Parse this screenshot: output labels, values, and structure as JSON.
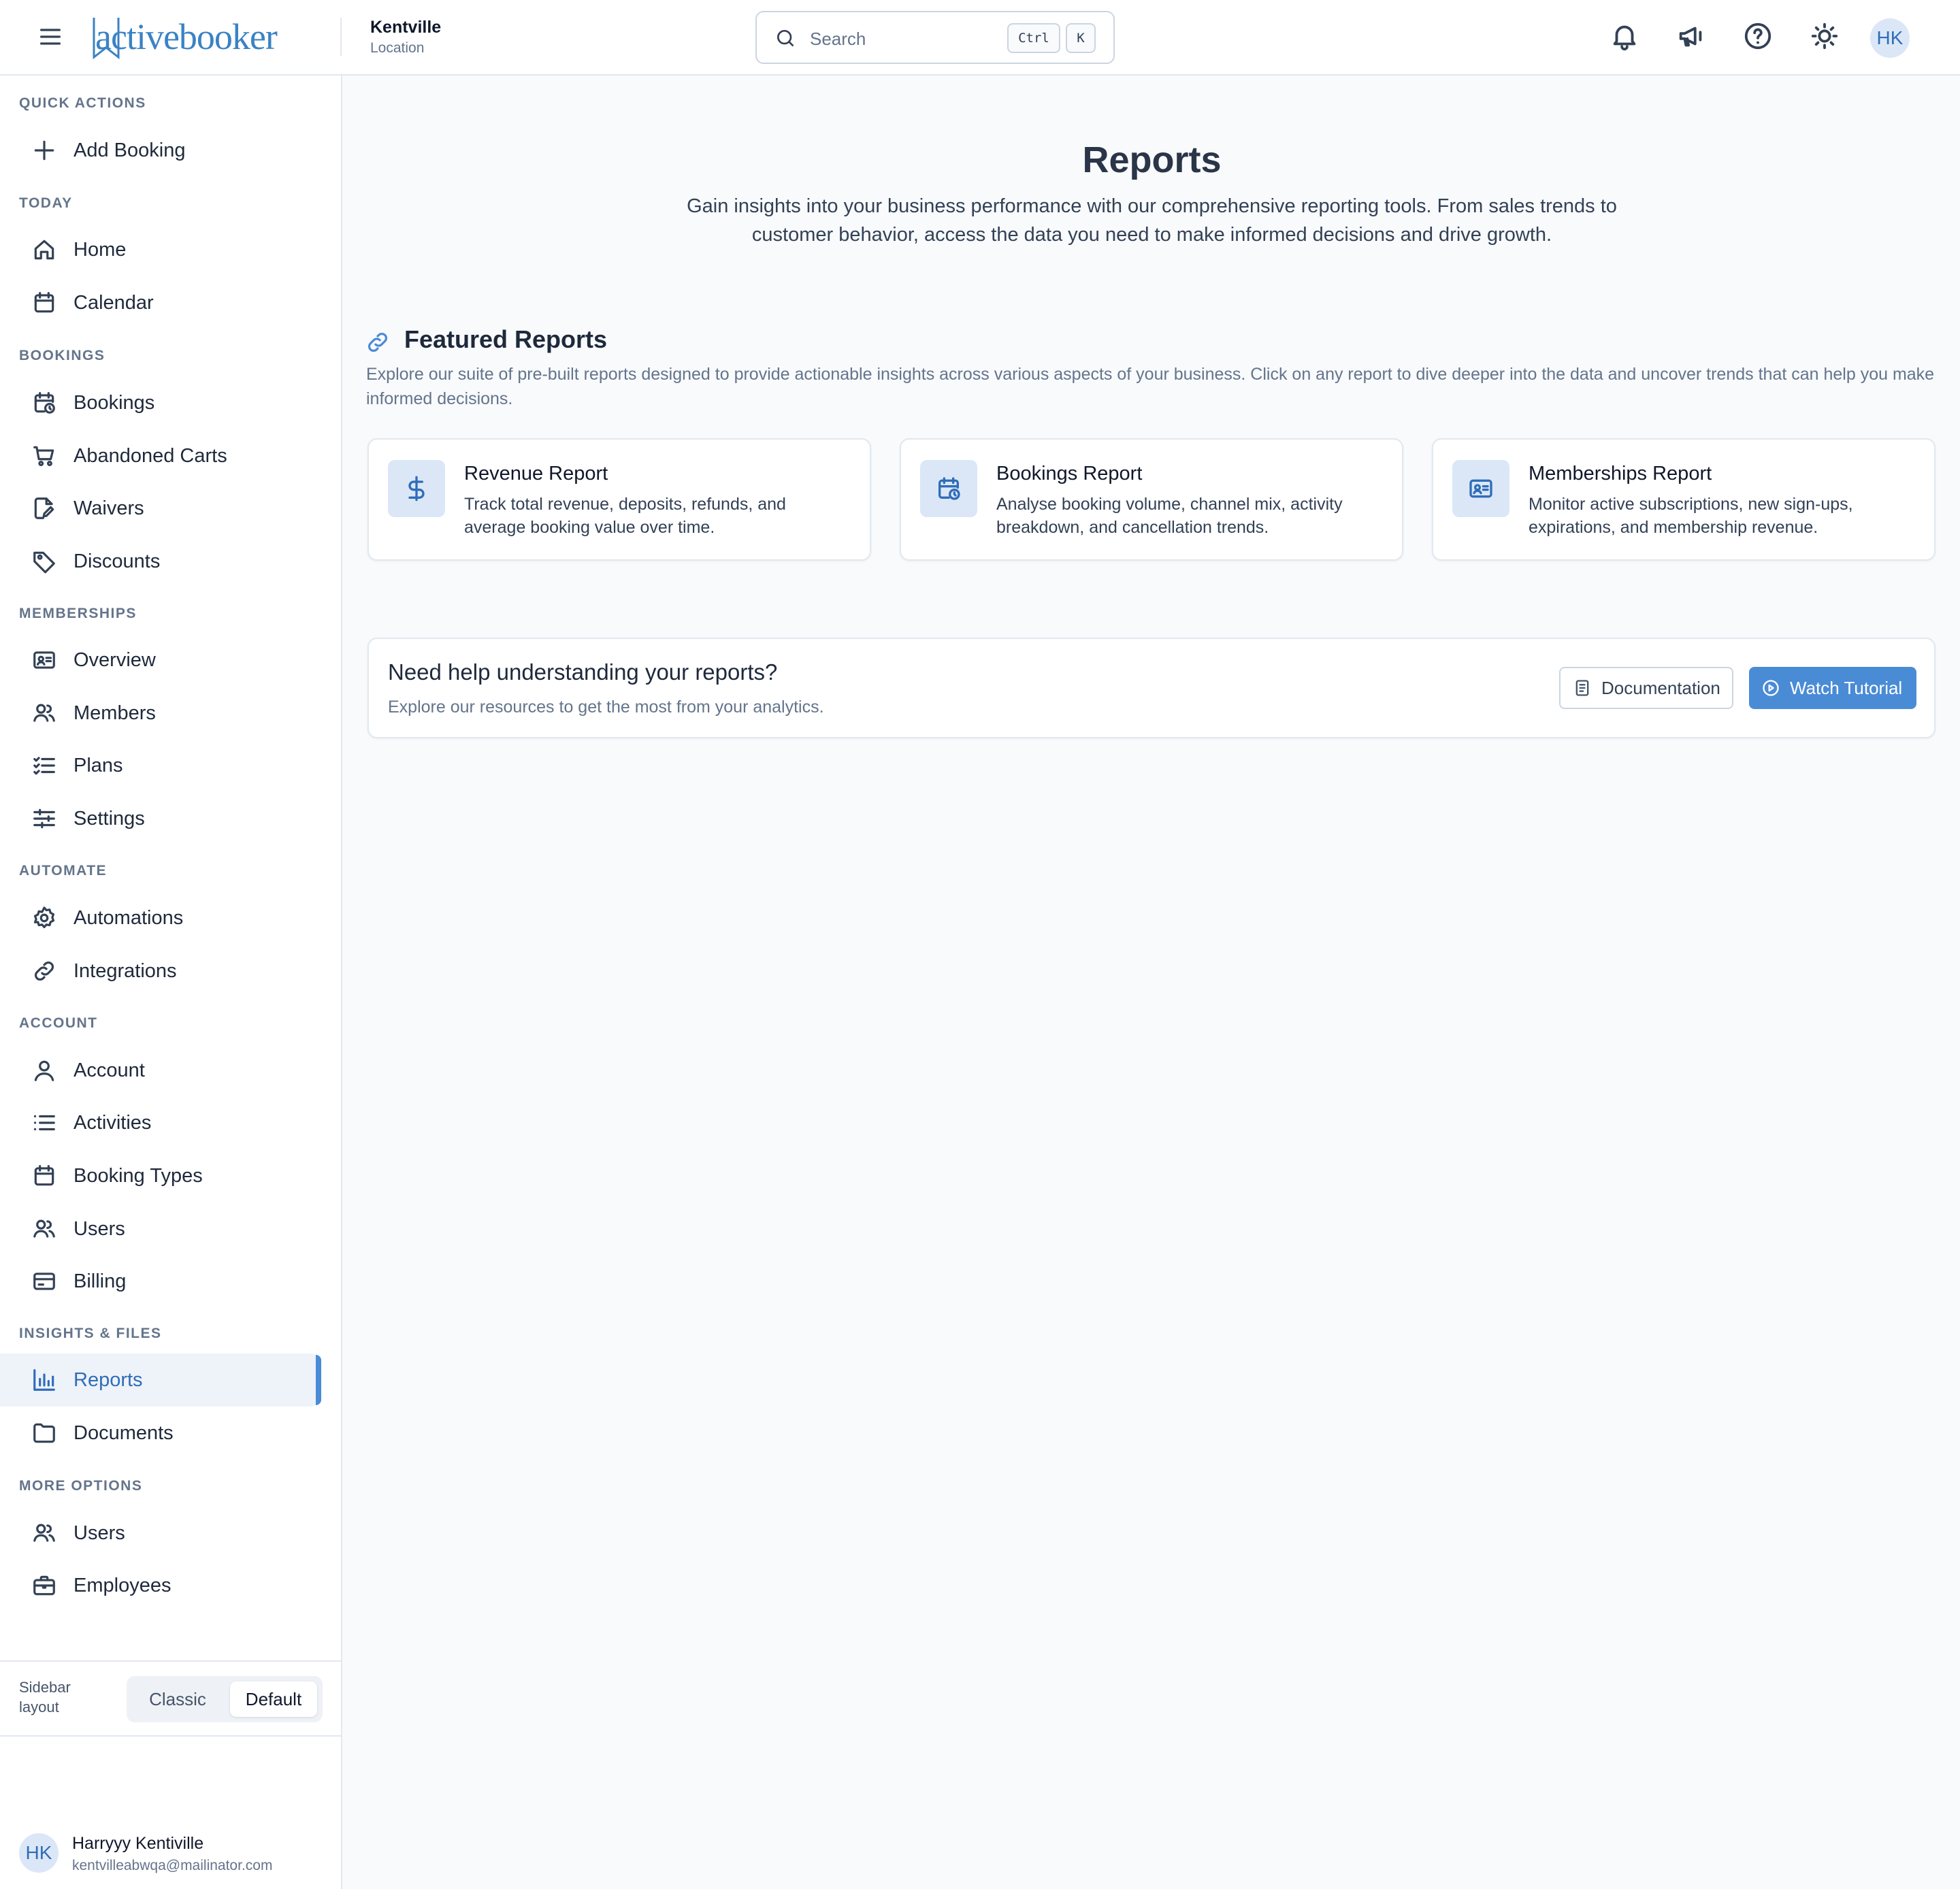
{
  "header": {
    "logo_text": "activebooker",
    "location_name": "Kentville",
    "location_label": "Location",
    "search_placeholder": "Search",
    "shortcut_ctrl": "Ctrl",
    "shortcut_key": "K",
    "avatar_initials": "HK"
  },
  "sidebar": {
    "sections": {
      "quick_actions": "QUICK ACTIONS",
      "today": "TODAY",
      "bookings": "BOOKINGS",
      "memberships": "MEMBERSHIPS",
      "automate": "AUTOMATE",
      "account": "ACCOUNT",
      "insights": "INSIGHTS & FILES",
      "more": "MORE OPTIONS"
    },
    "items": {
      "add_booking": "Add Booking",
      "home": "Home",
      "calendar": "Calendar",
      "bookings": "Bookings",
      "abandoned_carts": "Abandoned Carts",
      "waivers": "Waivers",
      "discounts": "Discounts",
      "overview": "Overview",
      "members": "Members",
      "plans": "Plans",
      "settings": "Settings",
      "automations": "Automations",
      "integrations": "Integrations",
      "account": "Account",
      "activities": "Activities",
      "booking_types": "Booking Types",
      "users": "Users",
      "billing": "Billing",
      "reports": "Reports",
      "documents": "Documents",
      "more_users": "Users",
      "employees": "Employees"
    },
    "active_item": "Reports",
    "layout_label": "Sidebar layout",
    "layout_options": [
      "Classic",
      "Default"
    ],
    "layout_selected": "Default",
    "user": {
      "initials": "HK",
      "name": "Harryyy Kentiville",
      "email": "kentvilleabwqa@mailinator.com"
    }
  },
  "main": {
    "title": "Reports",
    "subtitle": "Gain insights into your business performance with our comprehensive reporting tools. From sales trends to customer behavior, access the data you need to make informed decisions and drive growth.",
    "featured": {
      "title": "Featured Reports",
      "description": "Explore our suite of pre-built reports designed to provide actionable insights across various aspects of your business. Click on any report to dive deeper into the data and uncover trends that can help you make informed decisions.",
      "cards": [
        {
          "title": "Revenue Report",
          "description": "Track total revenue, deposits, refunds, and average booking value over time.",
          "icon": "dollar-icon"
        },
        {
          "title": "Bookings Report",
          "description": "Analyse booking volume, channel mix, activity breakdown, and cancellation trends.",
          "icon": "calendar-clock-icon"
        },
        {
          "title": "Memberships Report",
          "description": "Monitor active subscriptions, new sign-ups, expirations, and membership revenue.",
          "icon": "id-card-icon"
        }
      ]
    },
    "help": {
      "title": "Need help understanding your reports?",
      "subtitle": "Explore our resources to get the most from your analytics.",
      "documentation_label": "Documentation",
      "tutorial_label": "Watch Tutorial"
    }
  },
  "colors": {
    "accent": "#4a8bd6",
    "brand": "#3b82c4",
    "active_bg": "#eef2f9",
    "icon_tile": "#dbe7f7"
  }
}
